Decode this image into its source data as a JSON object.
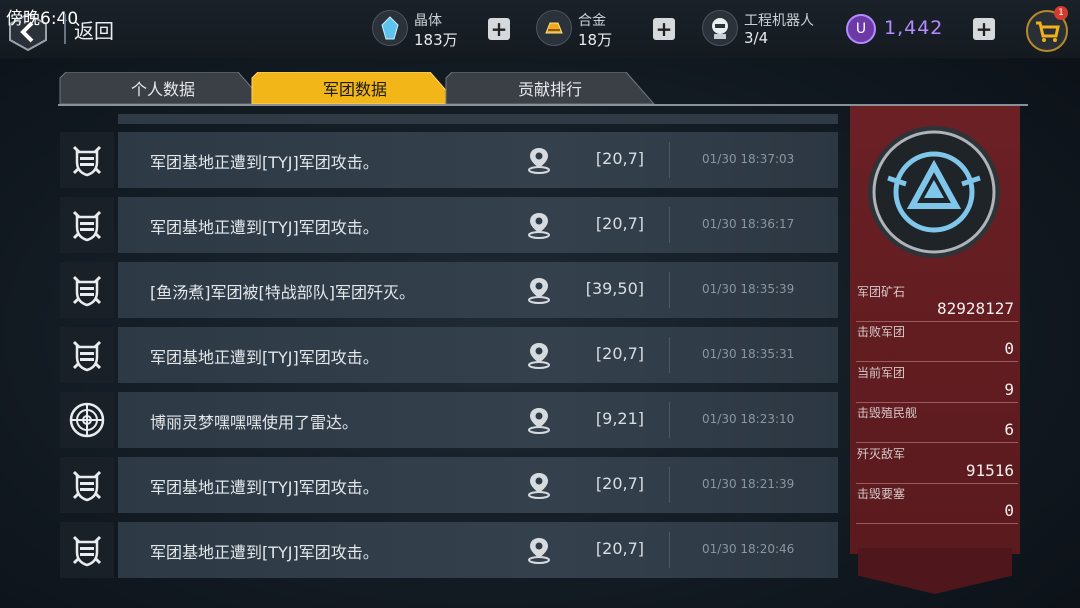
{
  "status": {
    "clock": "傍晚6:40"
  },
  "header": {
    "back_label": "返回",
    "resources": [
      {
        "name": "晶体",
        "value": "183万",
        "icon": "crystal-icon"
      },
      {
        "name": "合金",
        "value": "18万",
        "icon": "alloy-icon"
      },
      {
        "name": "工程机器人",
        "value": "3/4",
        "icon": "robot-icon"
      }
    ],
    "premium": {
      "badge": "U",
      "value": "1,442"
    },
    "cart_badge": "1"
  },
  "tabs": [
    {
      "label": "个人数据",
      "active": false
    },
    {
      "label": "军团数据",
      "active": true
    },
    {
      "label": "贡献排行",
      "active": false
    }
  ],
  "events": [
    {
      "type": "attack",
      "text": "军团基地正遭到[TYJ]军团攻击。",
      "coords": "[20,7]",
      "time": "01/30 18:37:03"
    },
    {
      "type": "attack",
      "text": "军团基地正遭到[TYJ]军团攻击。",
      "coords": "[20,7]",
      "time": "01/30 18:36:17"
    },
    {
      "type": "attack",
      "text": "[鱼汤煮]军团被[特战部队]军团歼灭。",
      "coords": "[39,50]",
      "time": "01/30 18:35:39"
    },
    {
      "type": "attack",
      "text": "军团基地正遭到[TYJ]军团攻击。",
      "coords": "[20,7]",
      "time": "01/30 18:35:31"
    },
    {
      "type": "radar",
      "text": "博丽灵梦嘿嘿嘿使用了雷达。",
      "coords": "[9,21]",
      "time": "01/30 18:23:10"
    },
    {
      "type": "attack",
      "text": "军团基地正遭到[TYJ]军团攻击。",
      "coords": "[20,7]",
      "time": "01/30 18:21:39"
    },
    {
      "type": "attack",
      "text": "军团基地正遭到[TYJ]军团攻击。",
      "coords": "[20,7]",
      "time": "01/30 18:20:46"
    }
  ],
  "stats": [
    {
      "label": "军团矿石",
      "value": "82928127"
    },
    {
      "label": "击败军团",
      "value": "0"
    },
    {
      "label": "当前军团",
      "value": "9"
    },
    {
      "label": "击毁殖民舰",
      "value": "6"
    },
    {
      "label": "歼灭敌军",
      "value": "91516"
    },
    {
      "label": "击毁要塞",
      "value": "0"
    }
  ],
  "colors": {
    "active_tab": "#f2b619",
    "panel": "#6b2024",
    "premium": "#b48cff"
  }
}
